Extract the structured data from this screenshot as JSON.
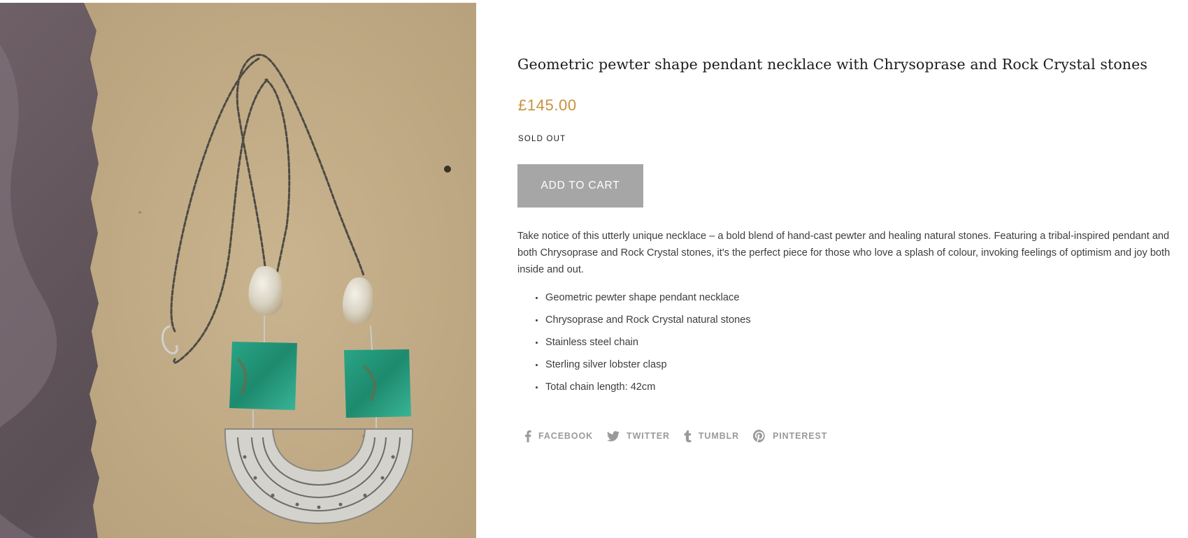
{
  "product": {
    "image_alt": "Geometric pewter necklace with green and clear stones on kraft paper",
    "title": "Geometric pewter shape pendant necklace with Chrysoprase and Rock Crystal stones",
    "price": "£145.00",
    "stock_status": "SOLD OUT",
    "add_to_cart_label": "ADD TO CART",
    "description": "Take notice of this utterly unique necklace – a bold blend of hand-cast pewter and healing natural stones. Featuring a tribal-inspired pendant and both Chrysoprase and Rock Crystal stones, it's the perfect piece for those who love a splash of colour, invoking feelings of optimism and joy both inside and out.",
    "features": [
      "Geometric pewter shape pendant necklace",
      "Chrysoprase and Rock Crystal natural stones",
      "Stainless steel chain",
      "Sterling silver lobster clasp",
      "Total chain length: 42cm"
    ]
  },
  "share": {
    "facebook": {
      "label": "FACEBOOK",
      "icon": "facebook-icon"
    },
    "twitter": {
      "label": "TWITTER",
      "icon": "twitter-icon"
    },
    "tumblr": {
      "label": "TUMBLR",
      "icon": "tumblr-icon"
    },
    "pinterest": {
      "label": "PINTEREST",
      "icon": "pinterest-icon"
    }
  },
  "colors": {
    "price": "#c8913d",
    "button_bg": "#a6a6a6",
    "share_text": "#9a9a9a",
    "body_text": "#3d3d3d"
  }
}
